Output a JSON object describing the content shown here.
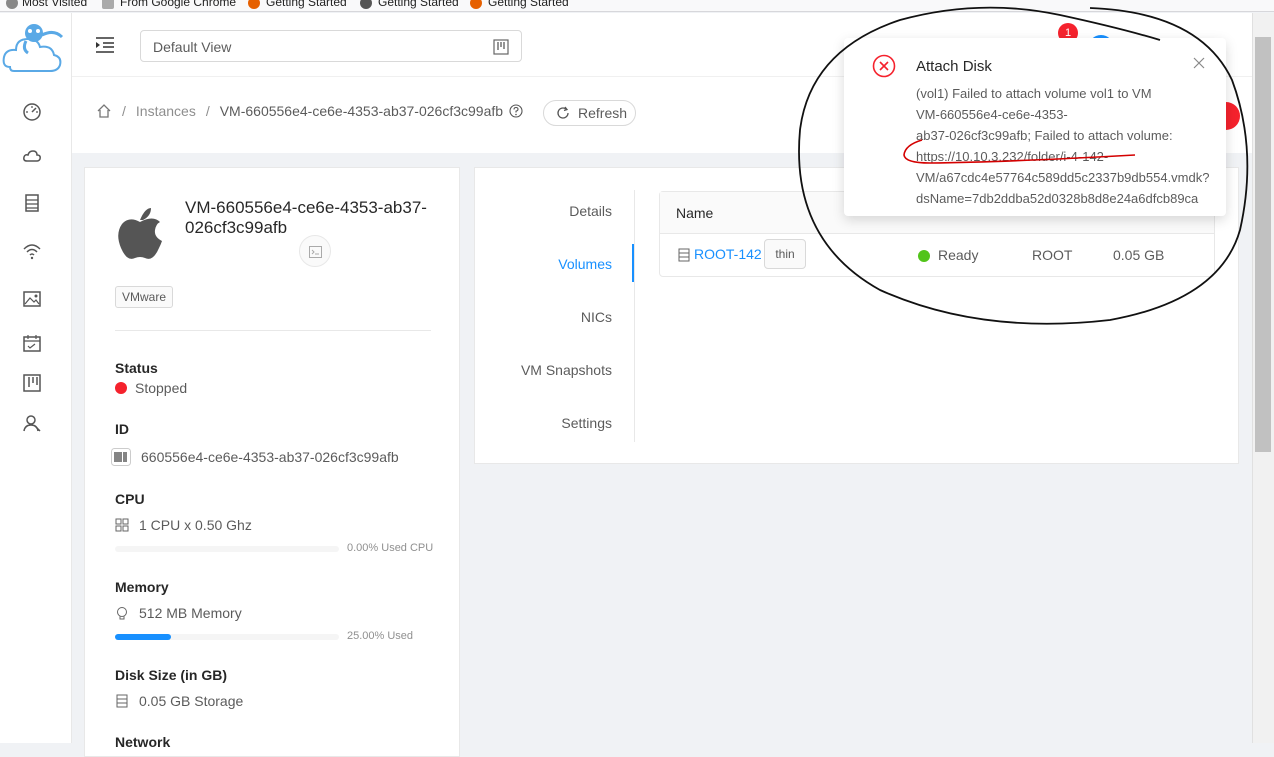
{
  "bookmarks": [
    {
      "label": "Most Visited"
    },
    {
      "label": "From Google Chrome"
    },
    {
      "label": "Getting Started"
    },
    {
      "label": "Getting Started"
    },
    {
      "label": "Getting Started"
    }
  ],
  "sidebar": {
    "items": [
      {
        "icon": "dashboard-icon"
      },
      {
        "icon": "cloud-icon"
      },
      {
        "icon": "storage-icon"
      },
      {
        "icon": "network-wifi-icon"
      },
      {
        "icon": "image-icon"
      },
      {
        "icon": "events-calendar-icon"
      },
      {
        "icon": "projects-icon"
      },
      {
        "icon": "accounts-icon"
      }
    ]
  },
  "header": {
    "view_select": "Default View",
    "notification_count": "1"
  },
  "breadcrumb": {
    "section": "Instances",
    "current": "VM-660556e4-ce6e-4353-ab37-026cf3c99afb",
    "refresh_label": "Refresh"
  },
  "instance": {
    "name": "VM-660556e4-ce6e-4353-ab37-026cf3c99afb",
    "hypervisor": "VMware",
    "status_title": "Status",
    "status": "Stopped",
    "id_title": "ID",
    "id": "660556e4-ce6e-4353-ab37-026cf3c99afb",
    "cpu_title": "CPU",
    "cpu": "1 CPU x 0.50 Ghz",
    "cpu_used_label": "0.00% Used CPU",
    "cpu_used_fraction": 0.0,
    "memory_title": "Memory",
    "memory": "512 MB Memory",
    "memory_used_label": "25.00% Used",
    "memory_used_fraction": 0.25,
    "disk_title": "Disk Size (in GB)",
    "disk": "0.05 GB Storage",
    "network_title": "Network"
  },
  "tabs": {
    "items": [
      "Details",
      "Volumes",
      "NICs",
      "VM Snapshots",
      "Settings"
    ],
    "active": "Volumes"
  },
  "volumes": {
    "header_name": "Name",
    "rows": [
      {
        "name": "ROOT-142",
        "tag": "thin",
        "state": "Ready",
        "type": "ROOT",
        "size": "0.05 GB"
      }
    ]
  },
  "notification": {
    "title": "Attach Disk",
    "lines": [
      "(vol1) Failed to attach volume vol1 to VM",
      "VM-660556e4-ce6e-4353-",
      "ab37-026cf3c99afb; Failed to attach volume:",
      "https://10.10.3.232/folder/i-4-142-",
      "VM/a67cdc4e57764c589dd5c2337b9db554.vmdk?",
      "dsName=7db2ddba52d0328b8d8e24a6dfcb89ca"
    ]
  },
  "colors": {
    "primary": "#1890ff",
    "error": "#f5222d",
    "success": "#52c41a"
  }
}
